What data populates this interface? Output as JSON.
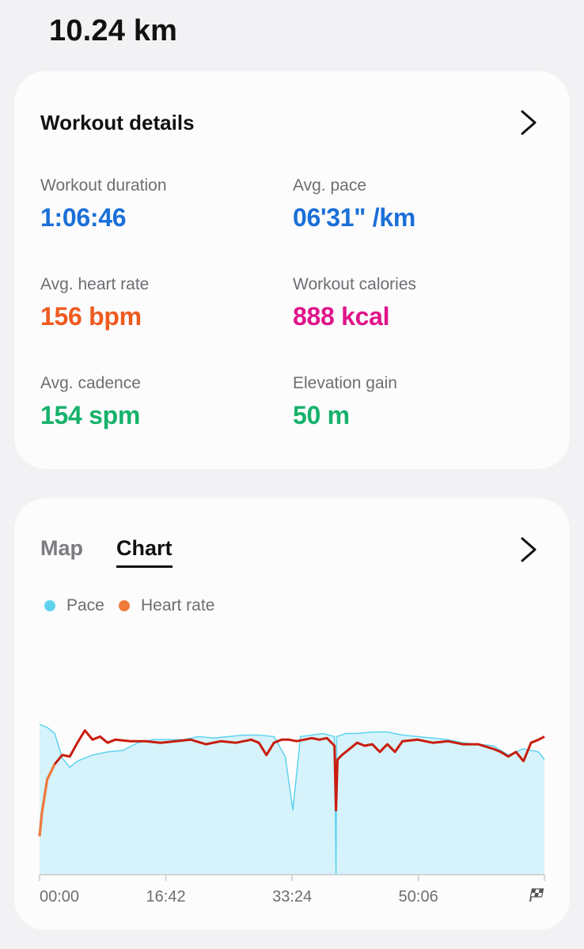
{
  "distance": "10.24 km",
  "details": {
    "title": "Workout details",
    "stats": [
      {
        "label": "Workout duration",
        "value": "1:06:46",
        "color": "#1a6fd8"
      },
      {
        "label": "Avg. pace",
        "value": "06'31\" /km",
        "color": "#1a6fd8"
      },
      {
        "label": "Avg. heart rate",
        "value": "156 bpm",
        "color": "#ef5a1f"
      },
      {
        "label": "Workout calories",
        "value": "888 kcal",
        "color": "#e0148a"
      },
      {
        "label": "Avg. cadence",
        "value": "154 spm",
        "color": "#16b26a"
      },
      {
        "label": "Elevation gain",
        "value": "50 m",
        "color": "#16b26a"
      }
    ]
  },
  "chart_card": {
    "tabs": [
      {
        "label": "Map",
        "active": false
      },
      {
        "label": "Chart",
        "active": true
      }
    ],
    "legend": [
      {
        "label": "Pace",
        "color": "#5fd3ee"
      },
      {
        "label": "Heart rate",
        "color": "#f07a3a"
      }
    ],
    "finish_icon": "checkered-flag-icon"
  },
  "chart_data": {
    "type": "area",
    "title": "",
    "xlabel": "",
    "ylabel": "",
    "x_tick_labels": [
      "00:00",
      "16:42",
      "33:24",
      "50:06"
    ],
    "xlim_minutes": [
      0,
      66.77
    ],
    "grid": false,
    "legend": "top-left",
    "series": [
      {
        "name": "Pace",
        "color": "#5fd3ee",
        "fill": "#d6f3fb",
        "x_minutes": [
          0,
          1,
          2,
          3,
          4,
          5,
          7,
          9,
          11,
          13,
          15,
          17,
          19,
          21,
          23,
          25,
          27,
          29,
          31,
          32.5,
          33.5,
          34.5,
          36,
          37.5,
          39,
          39.2,
          39.3,
          40.5,
          42,
          44,
          46,
          48,
          50,
          52,
          54,
          56,
          58,
          60,
          62,
          64,
          66,
          66.77
        ],
        "relative_level": [
          0.98,
          0.96,
          0.92,
          0.76,
          0.7,
          0.74,
          0.78,
          0.8,
          0.81,
          0.86,
          0.88,
          0.88,
          0.88,
          0.9,
          0.89,
          0.9,
          0.91,
          0.91,
          0.9,
          0.77,
          0.42,
          0.9,
          0.91,
          0.92,
          0.9,
          0.0,
          0.9,
          0.92,
          0.92,
          0.93,
          0.93,
          0.91,
          0.9,
          0.89,
          0.88,
          0.86,
          0.85,
          0.84,
          0.78,
          0.82,
          0.8,
          0.75
        ]
      },
      {
        "name": "Heart rate",
        "color": "#c81d0e",
        "x_minutes": [
          0,
          0.3,
          1,
          2,
          3,
          4,
          5,
          6,
          7,
          8,
          9,
          10,
          12,
          14,
          16,
          18,
          20,
          22,
          24,
          26,
          28,
          29,
          30,
          31,
          32,
          33,
          34,
          35,
          36,
          37,
          38,
          39,
          39.2,
          39.4,
          40,
          41,
          42,
          43,
          44,
          45,
          46,
          47,
          48,
          50,
          52,
          54,
          56,
          58,
          60,
          61,
          62,
          63,
          64,
          65,
          66,
          66.77
        ],
        "relative_level": [
          0.25,
          0.4,
          0.62,
          0.72,
          0.78,
          0.77,
          0.86,
          0.94,
          0.88,
          0.9,
          0.86,
          0.88,
          0.87,
          0.87,
          0.86,
          0.87,
          0.88,
          0.85,
          0.87,
          0.86,
          0.88,
          0.86,
          0.78,
          0.86,
          0.88,
          0.88,
          0.87,
          0.88,
          0.89,
          0.88,
          0.89,
          0.84,
          0.42,
          0.75,
          0.78,
          0.82,
          0.86,
          0.84,
          0.85,
          0.8,
          0.85,
          0.8,
          0.87,
          0.88,
          0.86,
          0.87,
          0.85,
          0.85,
          0.82,
          0.8,
          0.77,
          0.8,
          0.74,
          0.86,
          0.88,
          0.9
        ]
      }
    ]
  }
}
